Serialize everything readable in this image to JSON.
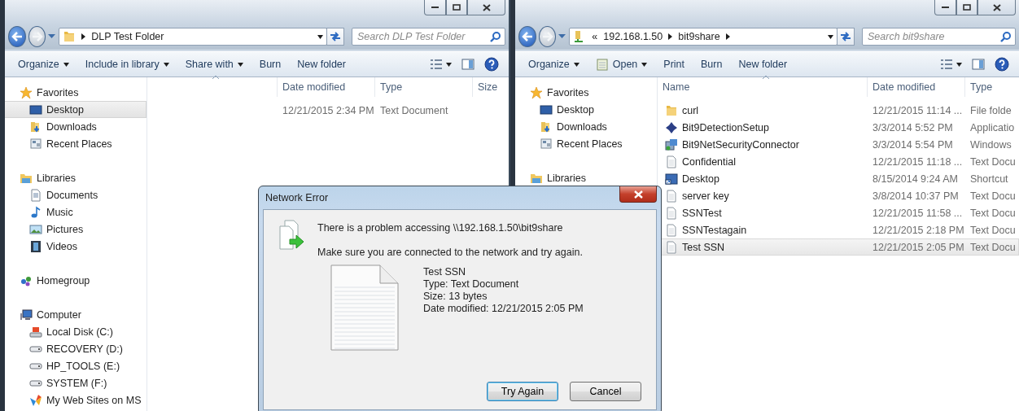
{
  "windows": [
    {
      "address": {
        "kind": "folder",
        "segments": [
          {
            "kind": "separator"
          },
          {
            "kind": "text",
            "text": "DLP Test Folder"
          }
        ]
      },
      "search": {
        "placeholder": "Search DLP Test Folder"
      },
      "toolbar": [
        {
          "kind": "command",
          "label": "Organize",
          "dropdown": true
        },
        {
          "kind": "command",
          "label": "Include in library",
          "dropdown": true
        },
        {
          "kind": "command",
          "label": "Share with",
          "dropdown": true
        },
        {
          "kind": "command",
          "label": "Burn",
          "dropdown": false
        },
        {
          "kind": "command",
          "label": "New folder",
          "dropdown": false
        }
      ],
      "nav": [
        {
          "kind": "star",
          "label": "Favorites",
          "children": [
            {
              "kind": "desktop",
              "label": "Desktop",
              "selected": true
            },
            {
              "kind": "downloads",
              "label": "Downloads",
              "selected": false
            },
            {
              "kind": "recent",
              "label": "Recent Places",
              "selected": false
            }
          ]
        },
        {
          "kind": "library",
          "label": "Libraries",
          "children": [
            {
              "kind": "documents",
              "label": "Documents",
              "selected": false
            },
            {
              "kind": "music",
              "label": "Music",
              "selected": false
            },
            {
              "kind": "pictures",
              "label": "Pictures",
              "selected": false
            },
            {
              "kind": "videos",
              "label": "Videos",
              "selected": false
            }
          ]
        },
        {
          "kind": "homegroup",
          "label": "Homegroup"
        },
        {
          "kind": "computer",
          "label": "Computer",
          "children": [
            {
              "kind": "system-disk",
              "label": "Local Disk (C:)",
              "selected": false
            },
            {
              "kind": "disk",
              "label": "RECOVERY (D:)",
              "selected": false
            },
            {
              "kind": "disk",
              "label": "HP_TOOLS (E:)",
              "selected": false
            },
            {
              "kind": "disk",
              "label": "SYSTEM (F:)",
              "selected": false
            },
            {
              "kind": "website",
              "label": "My Web Sites on MS",
              "selected": false
            }
          ]
        }
      ],
      "columns": [
        {
          "kind": "name",
          "sorted": true
        },
        {
          "kind": "date",
          "label": "Date modified",
          "sorted": false
        },
        {
          "kind": "type",
          "label": "Type",
          "sorted": false
        },
        {
          "kind": "size",
          "label": "Size",
          "sorted": false
        }
      ],
      "rows": [
        {
          "date": "12/21/2015 2:34 PM",
          "type": "Text Document",
          "selected": false
        }
      ]
    },
    {
      "address": {
        "kind": "network-share",
        "segments": [
          {
            "kind": "text",
            "text": "«"
          },
          {
            "kind": "text",
            "text": "192.168.1.50"
          },
          {
            "kind": "separator"
          },
          {
            "kind": "text",
            "text": "bit9share"
          },
          {
            "kind": "separator"
          }
        ]
      },
      "search": {
        "placeholder": "Search bit9share"
      },
      "toolbar": [
        {
          "kind": "command",
          "label": "Organize",
          "dropdown": true
        },
        {
          "kind": "open",
          "label": "Open",
          "dropdown": true
        },
        {
          "kind": "command",
          "label": "Print",
          "dropdown": false
        },
        {
          "kind": "command",
          "label": "Burn",
          "dropdown": false
        },
        {
          "kind": "command",
          "label": "New folder",
          "dropdown": false
        }
      ],
      "nav": [
        {
          "kind": "star",
          "label": "Favorites",
          "children": [
            {
              "kind": "desktop",
              "label": "Desktop",
              "selected": false
            },
            {
              "kind": "downloads",
              "label": "Downloads",
              "selected": false
            },
            {
              "kind": "recent",
              "label": "Recent Places",
              "selected": false
            }
          ]
        },
        {
          "kind": "library",
          "label": "Libraries"
        }
      ],
      "columns": [
        {
          "kind": "name",
          "label": "Name",
          "sorted": true
        },
        {
          "kind": "date",
          "label": "Date modified",
          "sorted": false
        },
        {
          "kind": "type",
          "label": "Type",
          "sorted": false
        }
      ],
      "rows": [
        {
          "kind": "folder",
          "name": "curl",
          "date": "12/21/2015 11:14 ...",
          "type": "File folde",
          "selected": false
        },
        {
          "kind": "setup",
          "name": "Bit9DetectionSetup",
          "date": "3/3/2014 5:52 PM",
          "type": "Applicatio",
          "selected": false
        },
        {
          "kind": "installer",
          "name": "Bit9NetSecurityConnector",
          "date": "3/3/2014 5:54 PM",
          "type": "Windows",
          "selected": false
        },
        {
          "kind": "text",
          "name": "Confidential",
          "date": "12/21/2015 11:18 ...",
          "type": "Text Docu",
          "selected": false
        },
        {
          "kind": "shortcut",
          "name": "Desktop",
          "date": "8/15/2014 9:24 AM",
          "type": "Shortcut",
          "selected": false
        },
        {
          "kind": "text",
          "name": "server key",
          "date": "3/8/2014 10:37 PM",
          "type": "Text Docu",
          "selected": false
        },
        {
          "kind": "text",
          "name": "SSNTest",
          "date": "12/21/2015 11:58 ...",
          "type": "Text Docu",
          "selected": false
        },
        {
          "kind": "text",
          "name": "SSNTestagain",
          "date": "12/21/2015 2:18 PM",
          "type": "Text Docu",
          "selected": false
        },
        {
          "kind": "text",
          "name": "Test SSN",
          "date": "12/21/2015 2:05 PM",
          "type": "Text Docu",
          "selected": true
        }
      ]
    }
  ],
  "dialog": {
    "title": "Network Error",
    "message": "There is a problem accessing \\\\192.168.1.50\\bit9share",
    "hint": "Make sure you are connected to the network and try again.",
    "file": {
      "name": "Test SSN",
      "type": "Type: Text Document",
      "size": "Size: 13 bytes",
      "modified": "Date modified: 12/21/2015 2:05 PM"
    },
    "buttons": [
      {
        "label": "Try Again",
        "default": true
      },
      {
        "label": "Cancel",
        "default": false
      }
    ]
  }
}
